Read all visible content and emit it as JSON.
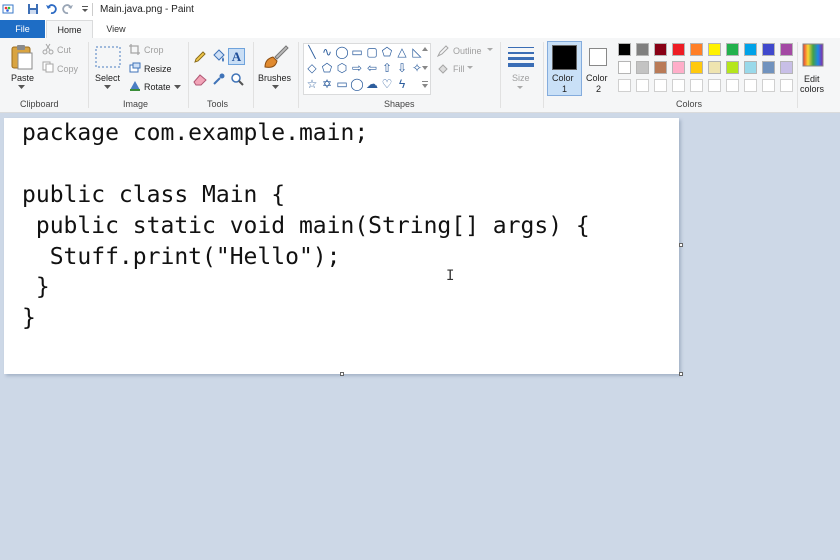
{
  "window": {
    "title": "Main.java.png - Paint"
  },
  "tabs": [
    {
      "label": "File",
      "active": false
    },
    {
      "label": "Home",
      "active": true
    },
    {
      "label": "View",
      "active": false
    }
  ],
  "clipboard": {
    "paste": "Paste",
    "cut": "Cut",
    "copy": "Copy",
    "label": "Clipboard"
  },
  "image": {
    "select": "Select",
    "crop": "Crop",
    "resize": "Resize",
    "rotate": "Rotate",
    "label": "Image"
  },
  "tools": {
    "label": "Tools"
  },
  "brushes": {
    "label": "Brushes"
  },
  "shapes": {
    "label": "Shapes",
    "outline": "Outline",
    "fill": "Fill",
    "items": [
      "line",
      "curve",
      "oval",
      "rectangle",
      "rounded-rectangle",
      "polygon",
      "triangle",
      "right-triangle",
      "diamond",
      "pentagon",
      "hexagon",
      "right-arrow",
      "left-arrow",
      "up-arrow",
      "down-arrow",
      "four-point-star",
      "five-point-star",
      "six-point-star",
      "rounded-callout",
      "oval-callout",
      "cloud-callout",
      "heart",
      "lightning"
    ]
  },
  "size": {
    "label": "Size"
  },
  "color1": {
    "label": "Color",
    "num": "1",
    "color": "#000000"
  },
  "color2": {
    "label": "Color",
    "num": "2",
    "color": "#ffffff"
  },
  "colors": {
    "label": "Colors",
    "edit_label_1": "Edit",
    "edit_label_2": "colors",
    "palette_row1": [
      "#000000",
      "#7f7f7f",
      "#880015",
      "#ed1c24",
      "#ff7f27",
      "#fff200",
      "#22b14c",
      "#00a2e8",
      "#3f48cc",
      "#a349a4"
    ],
    "palette_row2": [
      "#ffffff",
      "#c3c3c3",
      "#b97a57",
      "#ffaec9",
      "#ffc90e",
      "#efe4b0",
      "#b5e61d",
      "#99d9ea",
      "#7092be",
      "#c8bfe7"
    ]
  },
  "code_lines": [
    "package com.example.main;",
    "",
    "public class Main {",
    " public static void main(String[] args) {",
    "  Stuff.print(\"Hello\");",
    " }",
    "}"
  ]
}
